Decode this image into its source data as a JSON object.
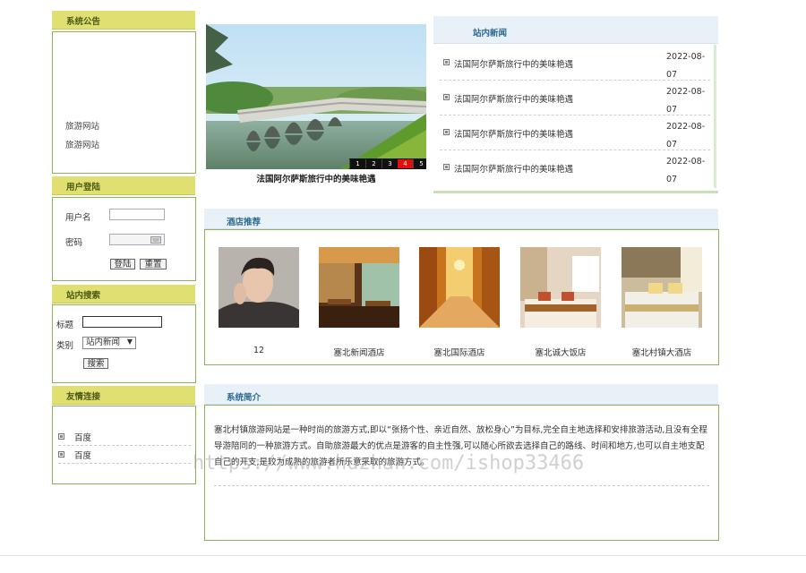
{
  "sidebar": {
    "announcement": {
      "title": "系统公告",
      "items": [
        "旅游网站",
        "旅游网站"
      ]
    },
    "login": {
      "title": "用户登陆",
      "username_label": "用户名",
      "password_label": "密码",
      "login_button": "登陆",
      "reset_button": "重置"
    },
    "search": {
      "title": "站内搜索",
      "title_label": "标题",
      "category_label": "类别",
      "category_value": "站内新闻",
      "submit_button": "搜索"
    },
    "links": {
      "title": "友情连接",
      "items": [
        "百度",
        "百度"
      ]
    }
  },
  "banner": {
    "caption": "法国阿尔萨斯旅行中的美味艳遇",
    "pages": [
      "1",
      "2",
      "3",
      "4",
      "5"
    ],
    "active_page": "4"
  },
  "news": {
    "title": "站内新闻",
    "items": [
      {
        "title": "法国阿尔萨斯旅行中的美味艳遇",
        "date_line1": "2022-08-",
        "date_line2": "07"
      },
      {
        "title": "法国阿尔萨斯旅行中的美味艳遇",
        "date_line1": "2022-08-",
        "date_line2": "07"
      },
      {
        "title": "法国阿尔萨斯旅行中的美味艳遇",
        "date_line1": "2022-08-",
        "date_line2": "07"
      },
      {
        "title": "法国阿尔萨斯旅行中的美味艳遇",
        "date_line1": "2022-08-",
        "date_line2": "07"
      }
    ]
  },
  "hotels": {
    "title": "酒店推荐",
    "items": [
      "12",
      "塞北新闻酒店",
      "塞北国际酒店",
      "塞北诚大饭店",
      "塞北村镇大酒店"
    ]
  },
  "intro": {
    "title": "系统简介",
    "text": "塞北村镇旅游网站是一种时尚的旅游方式,即以“张扬个性、亲近自然、放松身心”为目标,完全自主地选择和安排旅游活动,且没有全程导游陪同的一种旅游方式。自助旅游最大的优点是游客的自主性强,可以随心所欲去选择自己的路线、时间和地方,也可以自主地支配自己的开支,是较为成熟的旅游者所乐意采取的旅游方式。"
  },
  "watermark": "https://www.huzhan.com/ishop33466",
  "colors": {
    "panel_header": "#e0e072",
    "panel_border": "#8bb35c",
    "right_header_bg": "#e8f0f8",
    "right_header_text": "#2c6a92",
    "active_page": "#e01010"
  }
}
